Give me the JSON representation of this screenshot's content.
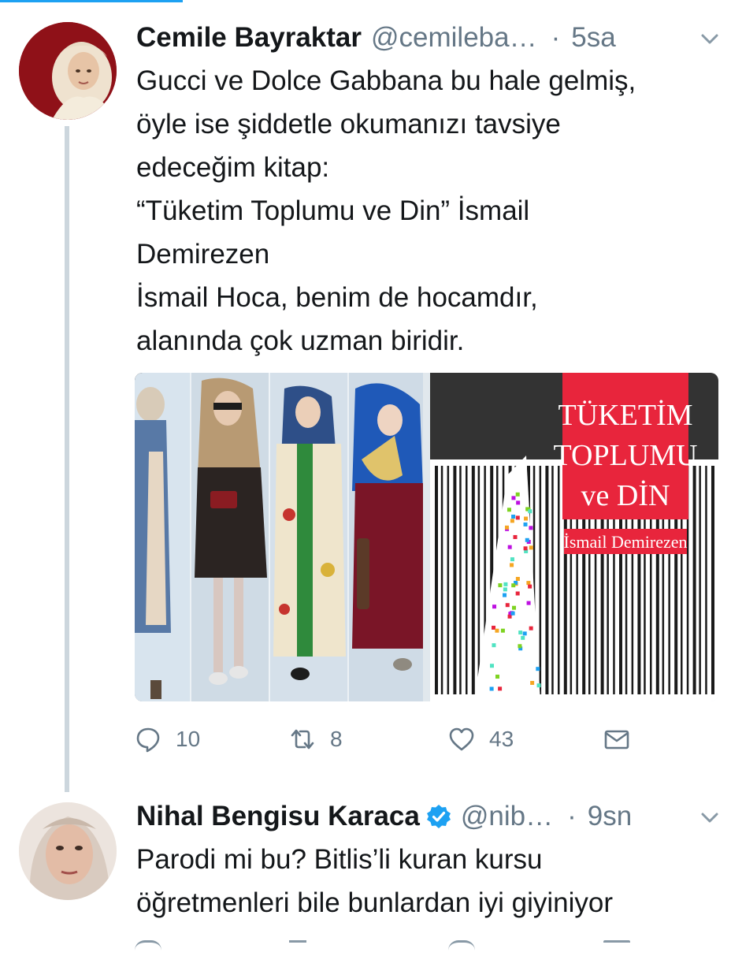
{
  "tweets": [
    {
      "author": {
        "name": "Cemile Bayraktar",
        "handle": "@cemileba…",
        "verified": false
      },
      "time": "5sa",
      "text_lines": [
        "Gucci ve Dolce Gabbana bu hale gelmiş,",
        "öyle ise şiddetle okumanızı tavsiye",
        "edeceğim kitap:",
        "“Tüketim Toplumu ve Din” İsmail",
        "Demirezen",
        "İsmail Hoca, benim de hocamdır,",
        "alanında çok uzman biridir."
      ],
      "media": {
        "book_cover": {
          "title_lines": [
            "TÜKETİM",
            "TOPLUMU",
            "ve DİN"
          ],
          "author": "İsmail Demirezen"
        }
      },
      "stats": {
        "replies": "10",
        "retweets": "8",
        "likes": "43"
      }
    },
    {
      "author": {
        "name": "Nihal Bengisu Karaca",
        "handle": "@nib…",
        "verified": true
      },
      "time": "9sn",
      "text_lines": [
        "Parodi mi bu? Bitlis’li kuran kursu",
        "öğretmenleri bile bunlardan iyi giyiniyor"
      ]
    }
  ],
  "icons": {
    "reply": "reply-icon",
    "retweet": "retweet-icon",
    "like": "heart-icon",
    "dm": "envelope-icon",
    "menu": "chevron-down-icon",
    "verified": "verified-badge-icon"
  },
  "colors": {
    "accent": "#1da1f2",
    "secondary_text": "#657786",
    "thread_line": "#ccd6dd",
    "book_red": "#e8253c"
  }
}
